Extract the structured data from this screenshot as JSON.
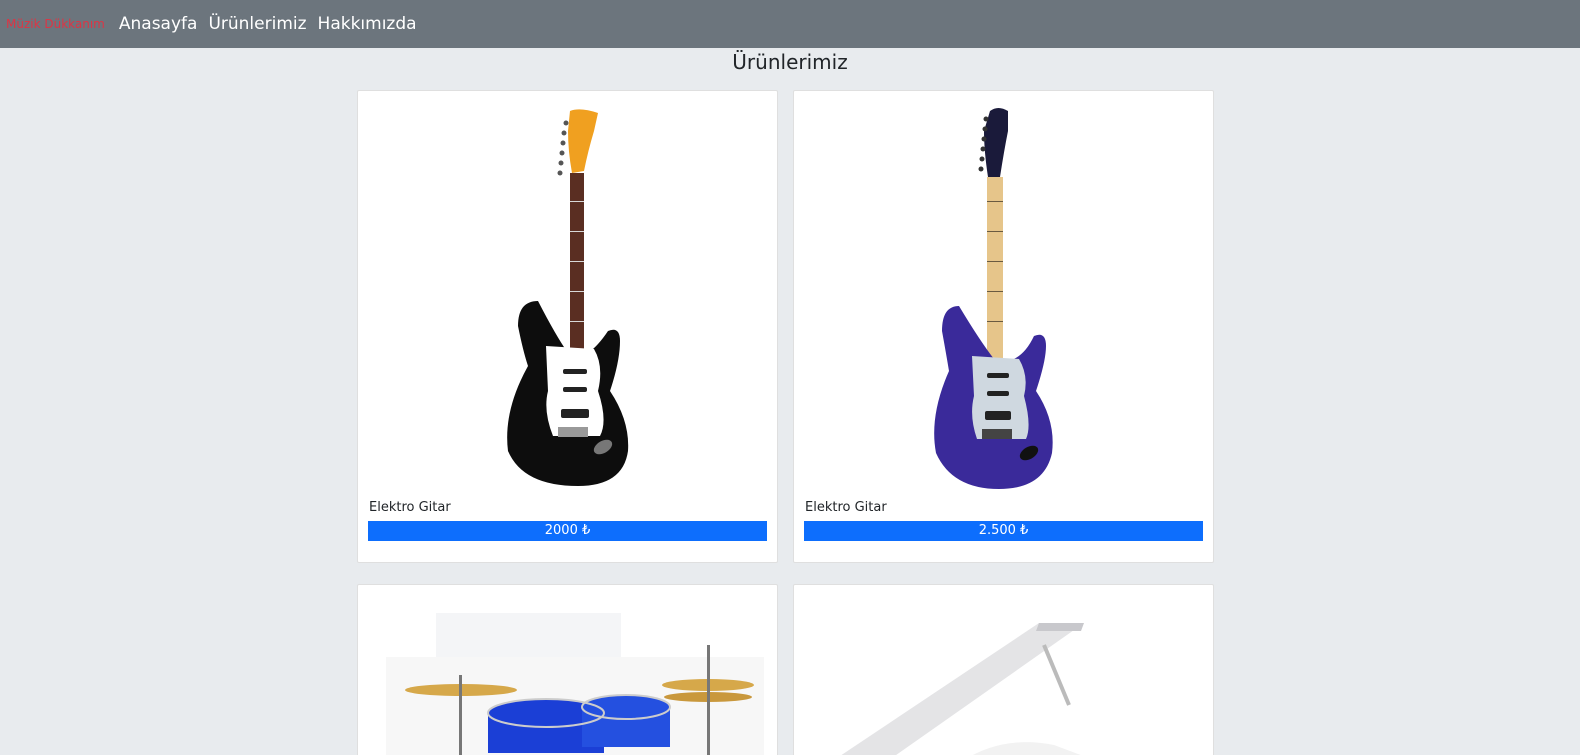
{
  "navbar": {
    "brand": "Müzik Dükkanım",
    "links": [
      "Anasayfa",
      "Ürünlerimiz",
      "Hakkımızda"
    ]
  },
  "page": {
    "title": "Ürünlerimiz"
  },
  "products": [
    {
      "name": "Elektro Gitar",
      "price": "2000 ₺",
      "image": "black-electric-guitar",
      "color": "#111111"
    },
    {
      "name": "Elektro Gitar",
      "price": "2.500 ₺",
      "image": "blue-electric-guitar",
      "color": "#3a2a9a"
    },
    {
      "name": "",
      "price": "",
      "image": "blue-drum-kit",
      "color": "#1b3fd6"
    },
    {
      "name": "",
      "price": "",
      "image": "white-grand-piano",
      "color": "#f2f2f2"
    }
  ],
  "colors": {
    "navbar": "#6c757d",
    "brand": "#dc3545",
    "background": "#e8ebee",
    "price_button": "#0d6efd"
  }
}
